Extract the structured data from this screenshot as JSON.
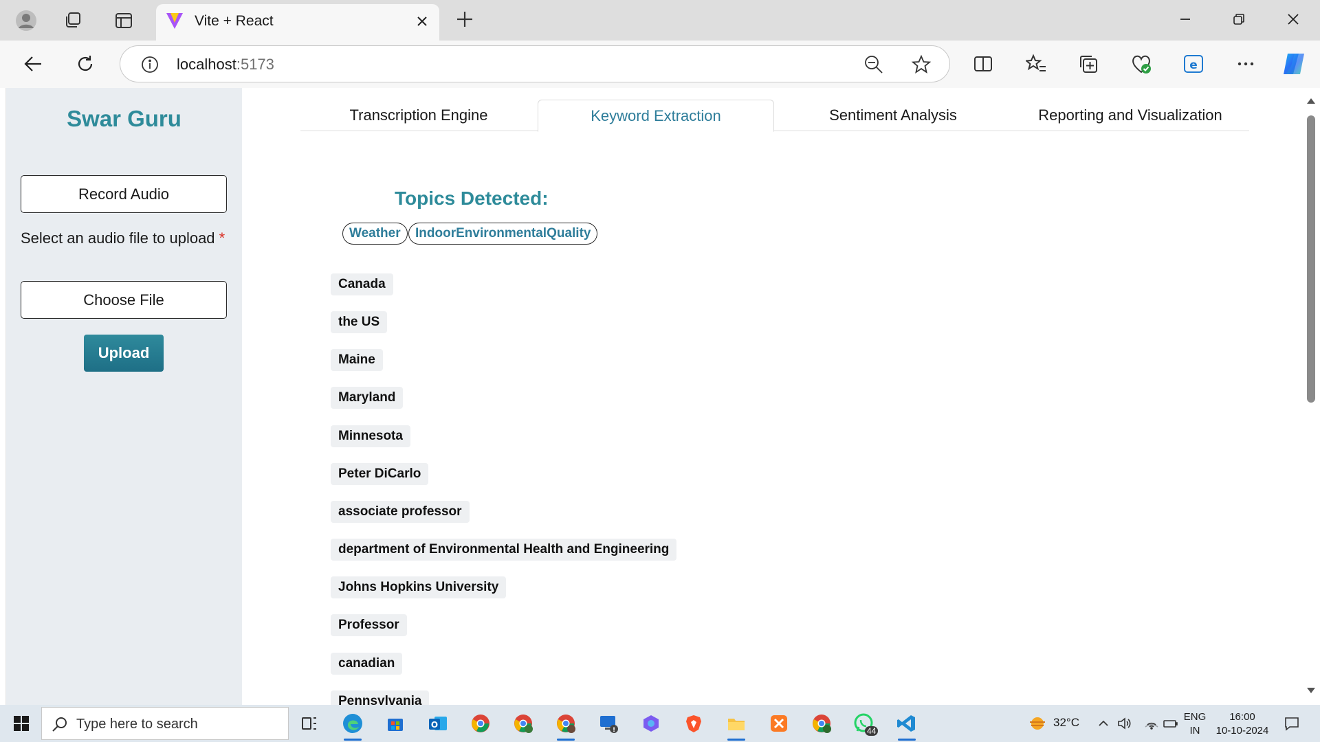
{
  "browser": {
    "tab_title": "Vite + React",
    "url_host": "localhost",
    "url_port": ":5173"
  },
  "sidebar": {
    "brand": "Swar Guru",
    "record_label": "Record Audio",
    "upload_prompt": "Select an audio file to upload",
    "required_mark": "*",
    "choose_file_label": "Choose File",
    "upload_label": "Upload"
  },
  "tabs": [
    {
      "label": "Transcription Engine",
      "active": false
    },
    {
      "label": "Keyword Extraction",
      "active": true
    },
    {
      "label": "Sentiment Analysis",
      "active": false
    },
    {
      "label": "Reporting and Visualization",
      "active": false
    }
  ],
  "topics": {
    "title": "Topics Detected:",
    "items": [
      "Weather",
      "IndoorEnvironmentalQuality"
    ]
  },
  "keywords": [
    "Canada",
    "the US",
    "Maine",
    "Maryland",
    "Minnesota",
    "Peter DiCarlo",
    "associate professor",
    "department of Environmental Health and Engineering",
    "Johns Hopkins University",
    "Professor",
    "canadian",
    "Pennsylvania"
  ],
  "taskbar": {
    "search_placeholder": "Type here to search",
    "temperature": "32°C",
    "lang_line1": "ENG",
    "lang_line2": "IN",
    "time": "16:00",
    "date": "10-10-2024",
    "whatsapp_badge": "44"
  },
  "colors": {
    "brand": "#2e8b9a",
    "upload_button": "#1e6f86",
    "active_tab_text": "#2e7d9a",
    "sidebar_bg": "#e9edf1",
    "keyword_bg": "#eef0f2"
  }
}
